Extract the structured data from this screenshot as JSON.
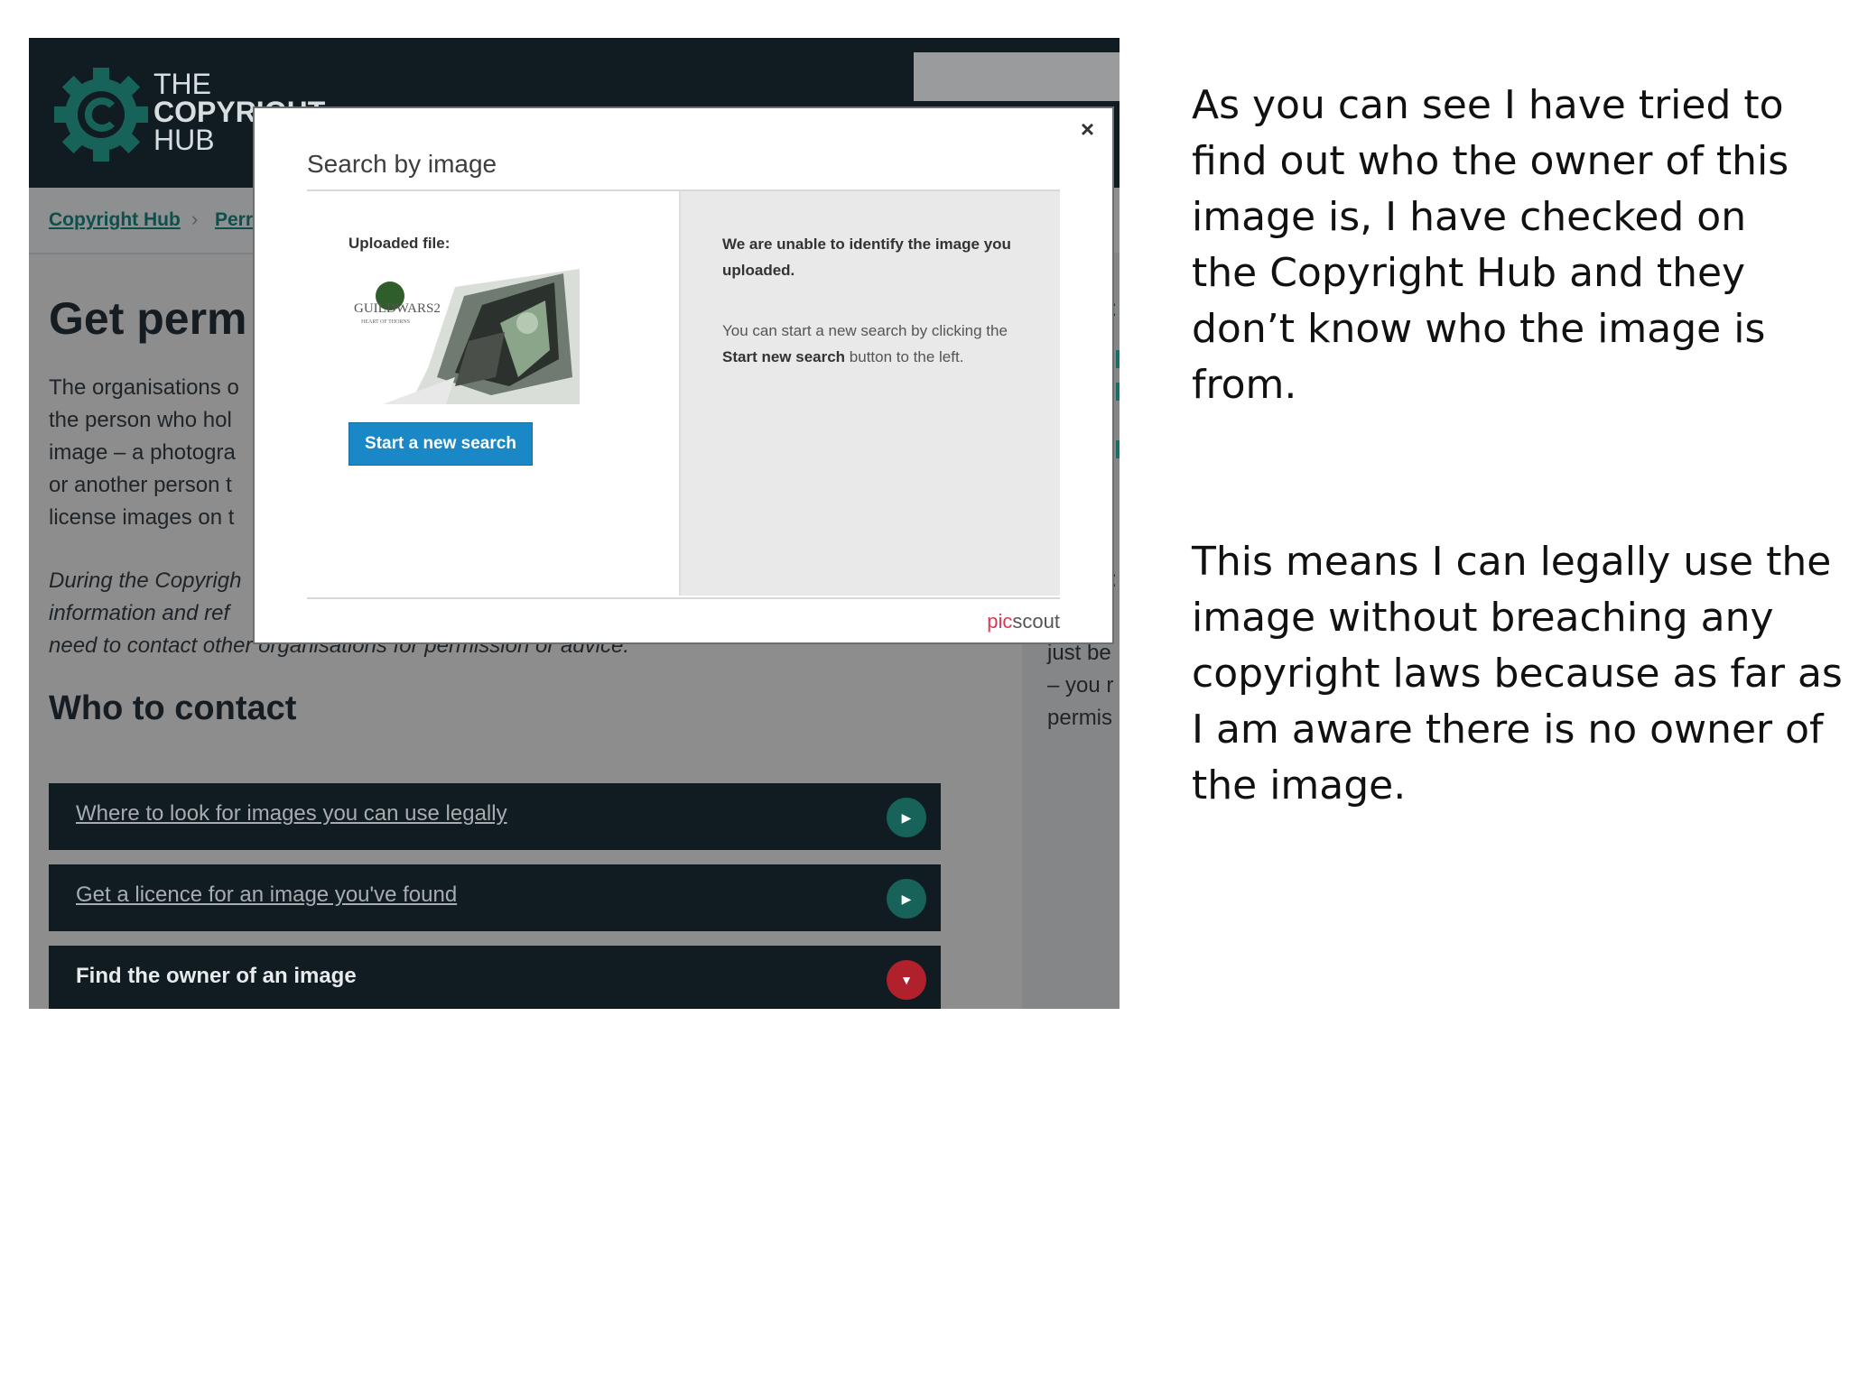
{
  "screenshot": {
    "logo": {
      "line1": "THE",
      "line2": "COPYRIGHT",
      "line3": "HUB"
    },
    "breadcrumb": {
      "home": "Copyright Hub",
      "current": "Perr"
    },
    "page_title": "Get perm",
    "intro_lines": [
      "The organisations o",
      "the person who hol",
      "image – a photogra",
      "or another person t",
      "license images on t"
    ],
    "italic_lines": [
      "During the Copyrigh",
      "information and ref"
    ],
    "italic_line3": "need to contact other organisations for permission or advice.",
    "section_title": "Who to contact",
    "accordion": [
      {
        "label": "Where to look for images you can use legally",
        "state": "collapsed"
      },
      {
        "label": "Get a licence for an image you've found",
        "state": "collapsed"
      },
      {
        "label": "Find the owner of an image",
        "state": "expanded"
      }
    ],
    "sidebar_lines": [
      "just be",
      "– you r",
      "permis"
    ],
    "colors": {
      "header": "#111b22",
      "teal": "#17635a",
      "red": "#b0212c",
      "button_blue": "#1a87c7"
    }
  },
  "modal": {
    "title": "Search by image",
    "close": "×",
    "uploaded_label": "Uploaded file:",
    "thumbnail_text": "GUILDWARS2",
    "thumbnail_subtext": "HEART OF THORNS",
    "start_button": "Start a new search",
    "message_primary": "We are unable to identify the image you uploaded.",
    "message_secondary_pre": "You can start a new search by clicking the ",
    "message_secondary_bold": "Start new search",
    "message_secondary_post": " button to the left.",
    "brand_pic": "pic",
    "brand_scout": "scout"
  },
  "slide": {
    "para1": [
      "As you can see I have tried to",
      "find out who the owner of this",
      "image is, I have checked on",
      "the Copyright Hub and they",
      "don’t know who the image is",
      "from."
    ],
    "para2": [
      "This means I can legally use the",
      "image without breaching any",
      "copyright laws because as far as",
      "I am aware there is no owner of",
      "the image."
    ]
  }
}
